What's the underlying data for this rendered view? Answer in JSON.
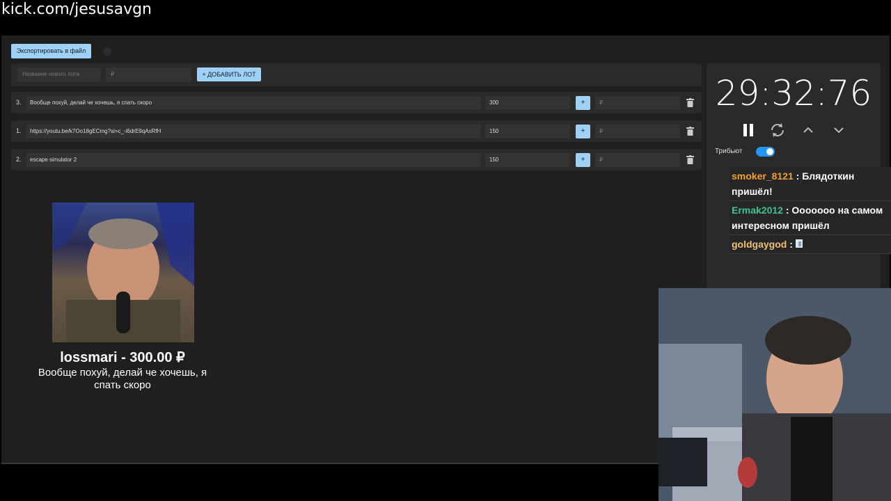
{
  "overlay": {
    "channel_url": "kick.com/jesusavgn"
  },
  "toolbar": {
    "export_label": "Экспортировать в файл"
  },
  "new_lot": {
    "name_placeholder": "Название нового лота",
    "amount_placeholder": "₽",
    "add_label": "+ ДОБАВИТЬ ЛОТ"
  },
  "lots": [
    {
      "rank": "3.",
      "name": "Вообще похуй, делай че хочешь, я спать скоро",
      "amount": "300",
      "plus": "+",
      "add_placeholder": "₽"
    },
    {
      "rank": "1.",
      "name": "https://youtu.be/k7Oo18gECmg?si=c_-i6drE9qAxRfH",
      "amount": "150",
      "plus": "+",
      "add_placeholder": "₽"
    },
    {
      "rank": "2.",
      "name": "escape simulator 2",
      "amount": "150",
      "plus": "+",
      "add_placeholder": "₽"
    }
  ],
  "winner": {
    "title": "lossmari - 300.00 ₽",
    "description": "Вообще похуй, делай че хочешь, я спать скоро"
  },
  "timer": {
    "value": "29:32:76"
  },
  "tribute": {
    "label": "Трибьют",
    "enabled": true
  },
  "chat": [
    {
      "user": "smoker_8121",
      "user_color": "#f0a030",
      "sep": " : ",
      "text": "Блядоткин пришёл!"
    },
    {
      "user": "Ermak2012",
      "user_color": "#3fc48f",
      "sep": " : ",
      "text": "Ооооооо на самом интересном пришёл"
    },
    {
      "user": "goldgaygod",
      "user_color": "#f0c070",
      "sep": " : ",
      "text": ""
    }
  ],
  "colors": {
    "accent": "#9fd1f7",
    "panel": "#2a2a2a",
    "background": "#1f1f1f",
    "toggle": "#2196f3"
  }
}
